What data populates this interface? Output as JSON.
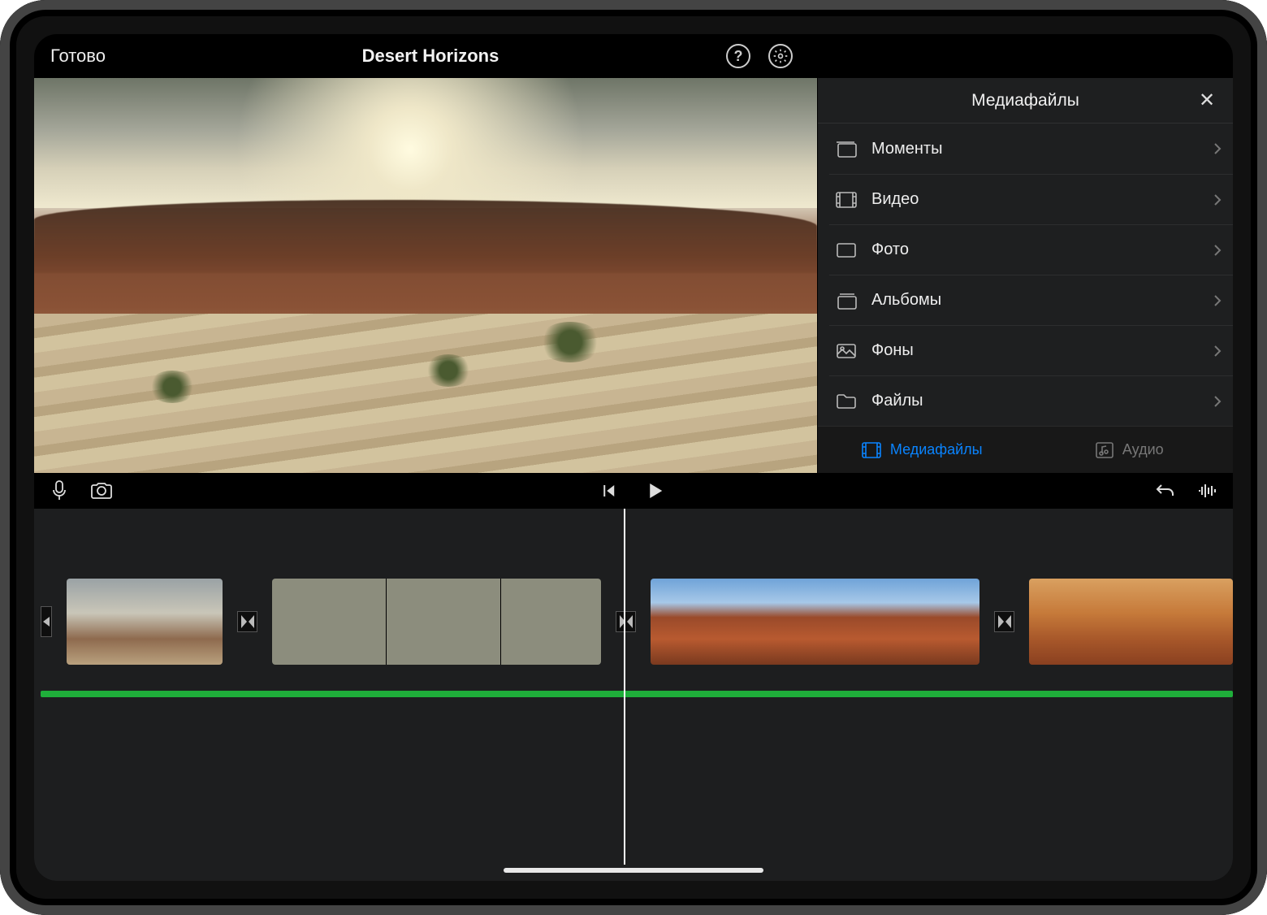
{
  "header": {
    "done_label": "Готово",
    "project_title": "Desert Horizons"
  },
  "media_panel": {
    "title": "Медиафайлы",
    "items": [
      {
        "label": "Моменты",
        "icon": "moments-icon"
      },
      {
        "label": "Видео",
        "icon": "video-icon"
      },
      {
        "label": "Фото",
        "icon": "photo-icon"
      },
      {
        "label": "Альбомы",
        "icon": "albums-icon"
      },
      {
        "label": "Фоны",
        "icon": "backgrounds-icon"
      },
      {
        "label": "Файлы",
        "icon": "files-icon"
      }
    ],
    "tabs": {
      "media_label": "Медиафайлы",
      "audio_label": "Аудио",
      "active": "media"
    }
  },
  "colors": {
    "accent": "#0a84ff",
    "audio_track": "#1fae3a"
  }
}
